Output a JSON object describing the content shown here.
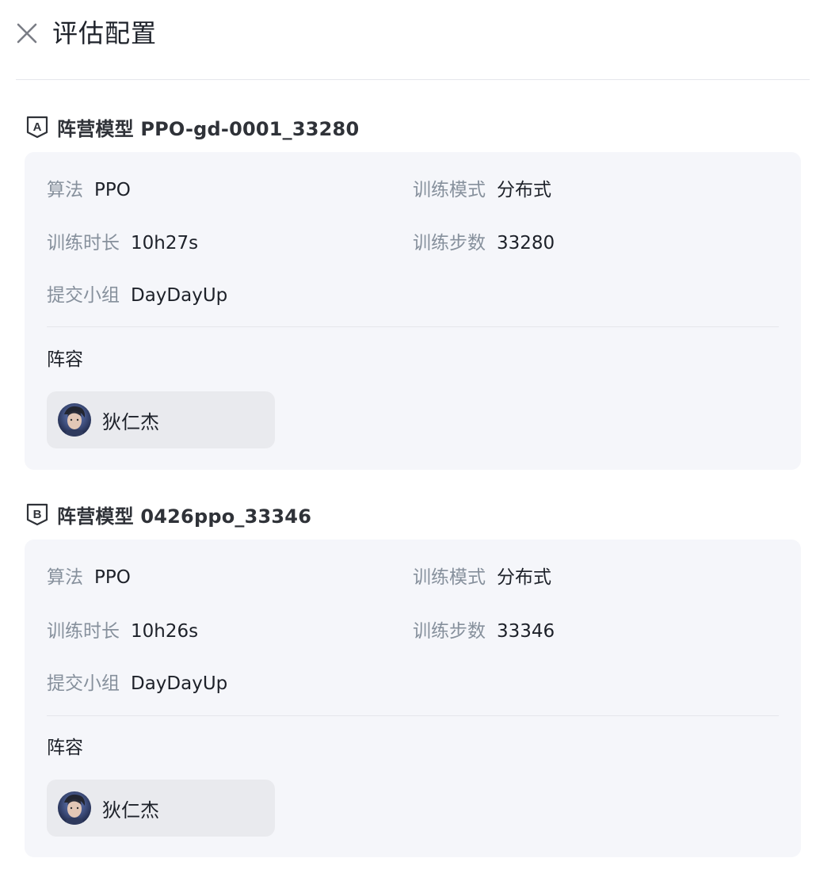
{
  "header": {
    "title": "评估配置"
  },
  "camps": [
    {
      "badge": "A",
      "title": "阵营模型 PPO-gd-0001_33280",
      "algorithm_label": "算法",
      "algorithm_value": "PPO",
      "mode_label": "训练模式",
      "mode_value": "分布式",
      "duration_label": "训练时长",
      "duration_value": "10h27s",
      "steps_label": "训练步数",
      "steps_value": "33280",
      "team_label": "提交小组",
      "team_value": "DayDayUp",
      "lineup_label": "阵容",
      "heroes": [
        {
          "name": "狄仁杰"
        }
      ]
    },
    {
      "badge": "B",
      "title": "阵营模型 0426ppo_33346",
      "algorithm_label": "算法",
      "algorithm_value": "PPO",
      "mode_label": "训练模式",
      "mode_value": "分布式",
      "duration_label": "训练时长",
      "duration_value": "10h26s",
      "steps_label": "训练步数",
      "steps_value": "33346",
      "team_label": "提交小组",
      "team_value": "DayDayUp",
      "lineup_label": "阵容",
      "heroes": [
        {
          "name": "狄仁杰"
        }
      ]
    }
  ],
  "colors": {
    "label": "#86909c",
    "text": "#1d2129",
    "card_bg": "#f5f6fa",
    "chip_bg": "#e9eaee"
  }
}
